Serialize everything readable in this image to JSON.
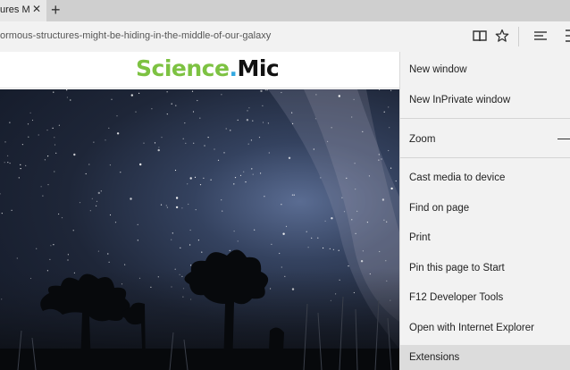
{
  "tab": {
    "title": "ures M",
    "close_glyph": "✕",
    "new_tab_glyph": "+"
  },
  "address": {
    "url": "ormous-structures-might-be-hiding-in-the-middle-of-our-galaxy"
  },
  "toolbar_icons": [
    "reading-view-icon",
    "favorite-star-icon",
    "hub-icon",
    "notes-icon"
  ],
  "page": {
    "logo": {
      "part1": "Science",
      "dot": ".",
      "part2": "Mic"
    },
    "colors": {
      "science": "#7dc242",
      "dot": "#33a8e0",
      "mic": "#111111"
    }
  },
  "menu": {
    "items": [
      "New window",
      "New InPrivate window",
      "Zoom",
      "Cast media to device",
      "Find on page",
      "Print",
      "Pin this page to Start",
      "F12 Developer Tools",
      "Open with Internet Explorer",
      "Extensions"
    ]
  }
}
